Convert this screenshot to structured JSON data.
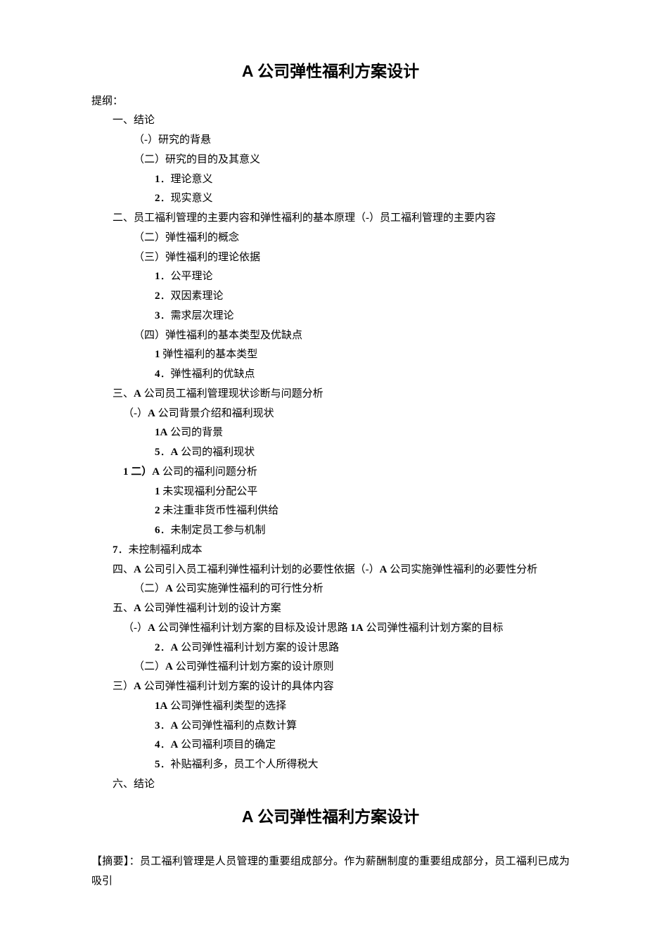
{
  "title_main": "A 公司弹性福利方案设计",
  "outline_label": "提纲：",
  "s1": "一、结论",
  "s1_1": "（-）研究的背悬",
  "s1_2": "（二）研究的目的及其意义",
  "s1_2_1_num": "1",
  "s1_2_1_txt": "．理论意义",
  "s1_2_2_num": "2",
  "s1_2_2_txt": "．现实意义",
  "s2": "二、员工福利管理的主要内容和弹性福利的基本原理（-）员工福利管理的主要内容",
  "s2_2": "（二）弹性福利的概念",
  "s2_3": "（三）弹性福利的理论依据",
  "s2_3_1_num": "1",
  "s2_3_1_txt": "．公平理论",
  "s2_3_2_num": "2",
  "s2_3_2_txt": "．双因素理论",
  "s2_3_3_num": "3",
  "s2_3_3_txt": "．需求层次理论",
  "s2_4": "（四）弹性福利的基本类型及优缺点",
  "s2_4_1_num": "1",
  "s2_4_1_txt": " 弹性福利的基本类型",
  "s2_4_2_num": "4",
  "s2_4_2_txt": "．弹性福利的优缺点",
  "s3_pre": "三、",
  "s3_lat": "A",
  "s3_post": " 公司员工福利管理现状诊断与问题分析",
  "s3_1_pre": "（-）",
  "s3_1_lat": "A",
  "s3_1_post": " 公司背景介绍和福利现状",
  "s3_1_1_num": "1A",
  "s3_1_1_txt": " 公司的背景",
  "s3_1_2_num": "5",
  "s3_1_2_txt": "．",
  "s3_1_2_lat": "A",
  "s3_1_2_post": " 公司的福利现状",
  "s3_2_pre": "1 二）",
  "s3_2_lat": "A",
  "s3_2_post": " 公司的福利问题分析",
  "s3_2_1_num": "1",
  "s3_2_1_txt": " 未实现福利分配公平",
  "s3_2_2_num": "2",
  "s3_2_2_txt": " 未注重非货币性福利供给",
  "s3_2_3_num": "6",
  "s3_2_3_txt": "．未制定员工参与机制",
  "s3_3_num": "7",
  "s3_3_txt": "．未控制福利成本",
  "s4_pre": "四、",
  "s4_lat": "A",
  "s4_mid": " 公司引入员工福利弹性福利计划的必要性依据（-）",
  "s4_lat2": "A",
  "s4_post": " 公司实施弹性福利的必要性分析",
  "s4_2_pre": "（二）",
  "s4_2_lat": "A",
  "s4_2_post": " 公司实施弹性福利的可行性分析",
  "s5_pre": "五、",
  "s5_lat": "A",
  "s5_post": " 公司弹性福利计划的设计方案",
  "s5_1_pre": "（-）",
  "s5_1_lat": "A",
  "s5_1_mid": " 公司弹性福利计划方案的目标及设计思路 ",
  "s5_1_num": "1A",
  "s5_1_post": " 公司弹性福利计划方案的目标",
  "s5_1_2_num": "2",
  "s5_1_2_txt": "．",
  "s5_1_2_lat": "A",
  "s5_1_2_post": " 公司弹性福利计划方案的设计思路",
  "s5_2_pre": "（二）",
  "s5_2_lat": "A",
  "s5_2_post": " 公司弹性福利计划方案的设计原则",
  "s5_3_pre": "三）",
  "s5_3_lat": "A",
  "s5_3_post": " 公司弹性福利计划方案的设计的具体内容",
  "s5_3_1_num": "1A",
  "s5_3_1_txt": " 公司弹性福利类型的选择",
  "s5_3_2_num": "3",
  "s5_3_2_txt": "．",
  "s5_3_2_lat": "A",
  "s5_3_2_post": " 公司弹性福利的点数计算",
  "s5_3_3_num": "4",
  "s5_3_3_txt": "．",
  "s5_3_3_lat": "A",
  "s5_3_3_post": " 公司福利项目的确定",
  "s5_3_4_num": "5",
  "s5_3_4_txt": "．补贴福利多，员工个人所得税大",
  "s6": "六、结论",
  "title_second": "A 公司弹性福利方案设计",
  "abstract": "【摘要】：员工福利管理是人员管理的重要组成部分。作为薪酬制度的重要组成部分，员工福利已成为吸引"
}
